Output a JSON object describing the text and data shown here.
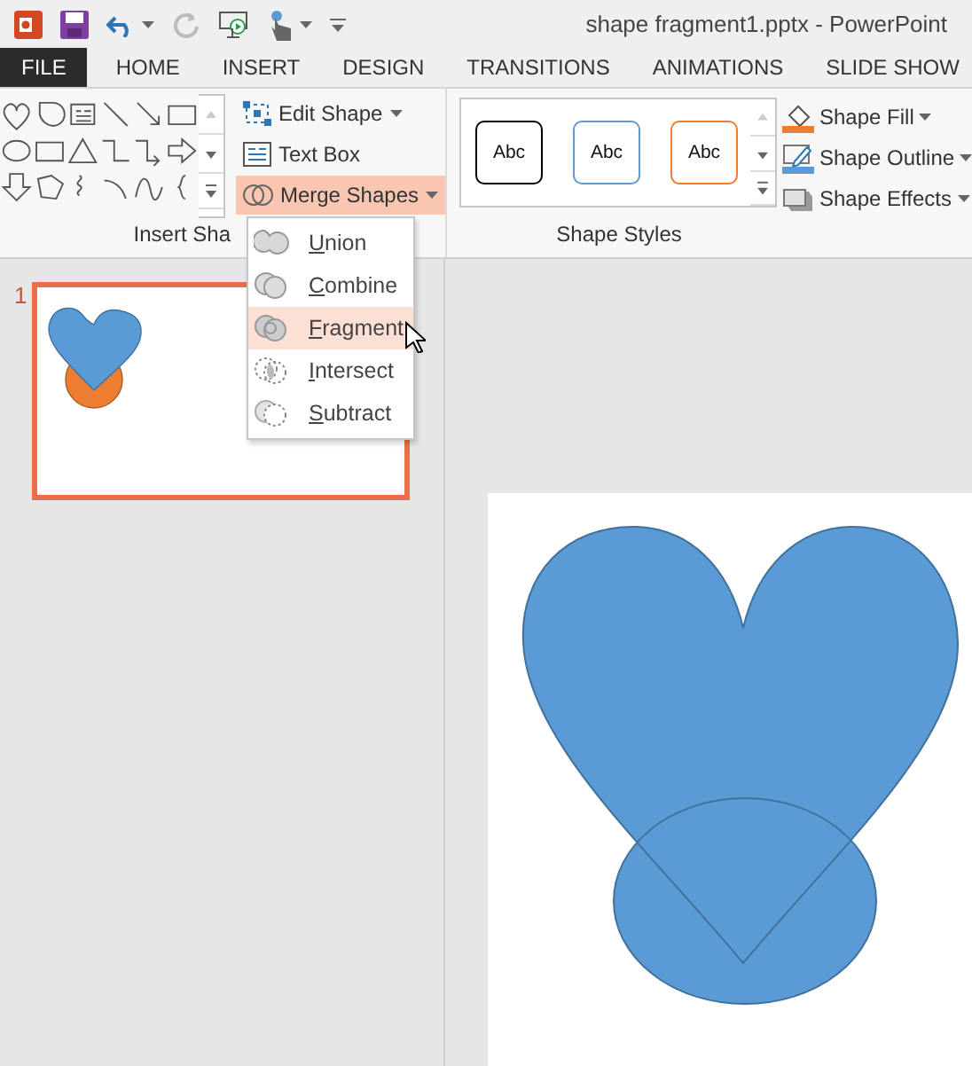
{
  "window": {
    "title": "shape fragment1.pptx - PowerPoint"
  },
  "tabs": [
    {
      "label": "FILE",
      "kind": "file"
    },
    {
      "label": "HOME",
      "kind": "tab"
    },
    {
      "label": "INSERT",
      "kind": "tab"
    },
    {
      "label": "DESIGN",
      "kind": "tab"
    },
    {
      "label": "TRANSITIONS",
      "kind": "tab"
    },
    {
      "label": "ANIMATIONS",
      "kind": "tab"
    },
    {
      "label": "SLIDE SHOW",
      "kind": "tab"
    }
  ],
  "ribbon": {
    "insert_shapes": {
      "label": "Insert Sha",
      "commands": [
        {
          "label": "Edit Shape",
          "dropdown": true,
          "selected": false
        },
        {
          "label": "Text Box",
          "dropdown": false,
          "selected": false
        },
        {
          "label": "Merge Shapes",
          "dropdown": true,
          "selected": true
        }
      ]
    },
    "shape_styles": {
      "label": "Shape Styles",
      "presets": [
        {
          "label": "Abc",
          "color": "#000000"
        },
        {
          "label": "Abc",
          "color": "#5b9bd5"
        },
        {
          "label": "Abc",
          "color": "#ed7d31"
        }
      ],
      "commands": [
        {
          "label": "Shape Fill",
          "dropdown": true
        },
        {
          "label": "Shape Outline",
          "dropdown": true
        },
        {
          "label": "Shape Effects",
          "dropdown": true
        }
      ]
    }
  },
  "merge_menu": {
    "items": [
      {
        "label": "Union",
        "selected": false
      },
      {
        "label": "Combine",
        "selected": false
      },
      {
        "label": "Fragment",
        "selected": true
      },
      {
        "label": "Intersect",
        "selected": false
      },
      {
        "label": "Subtract",
        "selected": false
      }
    ]
  },
  "slides": [
    {
      "number": "1",
      "selected": true
    }
  ]
}
